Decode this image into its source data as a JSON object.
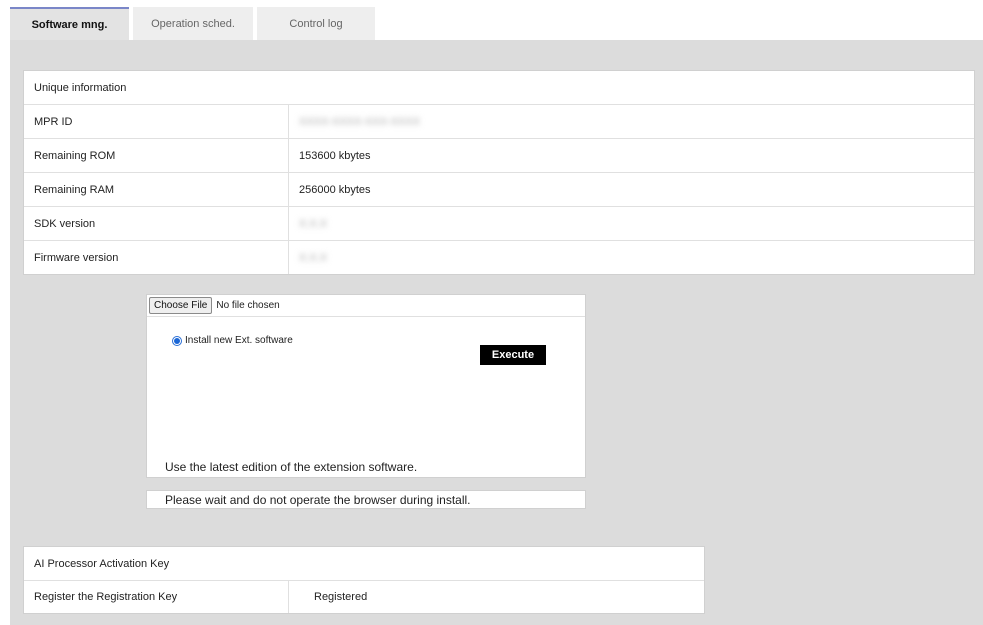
{
  "tabs": [
    {
      "label": "Software mng.",
      "active": true
    },
    {
      "label": "Operation sched.",
      "active": false
    },
    {
      "label": "Control log",
      "active": false
    }
  ],
  "unique_info": {
    "header": "Unique information",
    "rows": [
      {
        "label": "MPR ID",
        "value": "XXXX-XXXX-XXX-XXXX"
      },
      {
        "label": "Remaining ROM",
        "value": "153600 kbytes"
      },
      {
        "label": "Remaining RAM",
        "value": "256000 kbytes"
      },
      {
        "label": "SDK version",
        "value": "X.X.X"
      },
      {
        "label": "Firmware version",
        "value": "X.X.X"
      }
    ]
  },
  "install": {
    "choose_file_label": "Choose File",
    "file_status": "No file chosen",
    "radio_label": "Install new Ext. software",
    "execute_label": "Execute",
    "note": "Use the latest edition of the extension software.",
    "wait_message": "Please wait and do not operate the browser during install."
  },
  "ai_key": {
    "header": "AI Processor Activation Key",
    "row_label": "Register the Registration Key",
    "row_value": "Registered"
  },
  "colors": {
    "panel_bg": "#dcdcdc",
    "active_tab_accent": "#7a86c8",
    "execute_bg": "#000000",
    "radio_accent": "#1a66d6"
  }
}
